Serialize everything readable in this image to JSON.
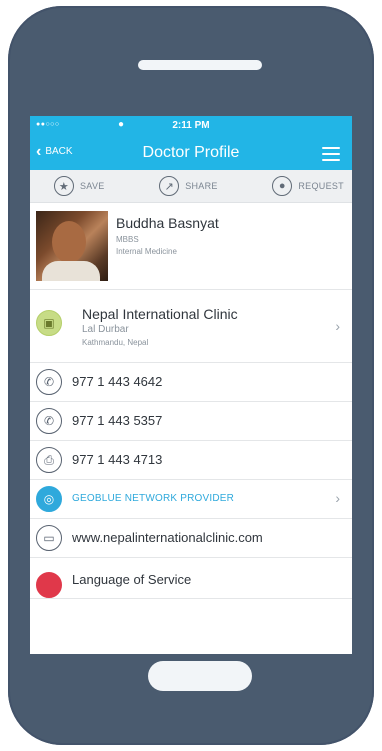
{
  "status_bar": {
    "signal": "●●○○○",
    "time": "2:11 PM"
  },
  "nav": {
    "back_label": "BACK",
    "title": "Doctor Profile"
  },
  "actions": {
    "save": "SAVE",
    "share": "SHARE",
    "request": "REQUEST"
  },
  "doctor": {
    "name": "Buddha Basnyat",
    "degree": "MBBS",
    "specialty": "Internal Medicine"
  },
  "clinic": {
    "name": "Nepal International Clinic",
    "area": "Lal Durbar",
    "city": "Kathmandu, Nepal"
  },
  "phones": [
    "977 1 443 4642",
    "977 1 443 5357"
  ],
  "fax": "977 1 443 4713",
  "network": "GEOBLUE NETWORK PROVIDER",
  "website": "www.nepalinternationalclinic.com",
  "language_label": "Language of Service",
  "colors": {
    "accent": "#22b5e6",
    "phone_body": "#4a5b6f",
    "network_text": "#2fa9dc"
  },
  "icons": {
    "save": "star-icon",
    "share": "share-icon",
    "request": "request-icon",
    "clinic": "map-icon",
    "phone": "phone-icon",
    "fax": "fax-icon",
    "network": "geoblue-icon",
    "website": "browser-icon",
    "language": "language-icon"
  }
}
